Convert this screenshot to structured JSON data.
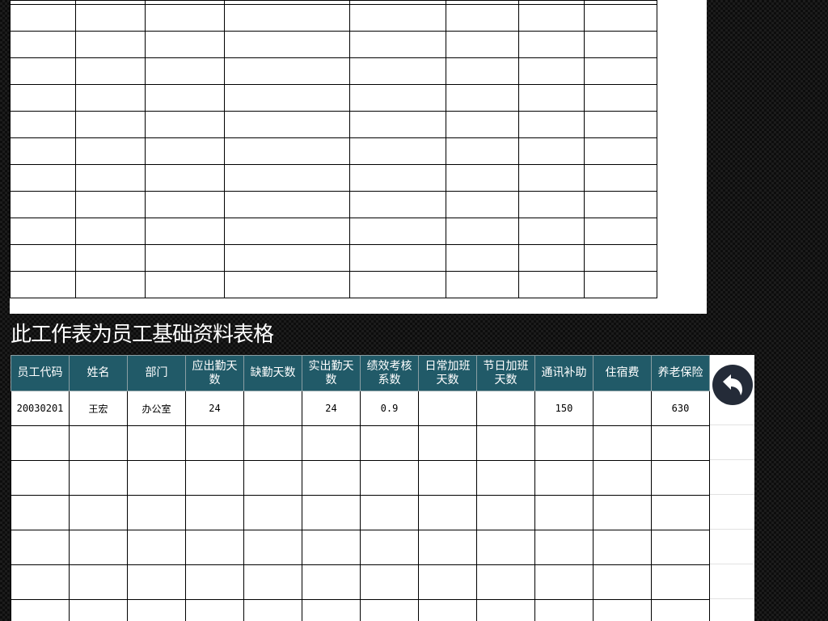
{
  "sheet": {
    "title": "此工作表为员工基础资料表格"
  },
  "employee_table": {
    "columns": [
      "员工代码",
      "姓名",
      "部门",
      "应出勤天数",
      "缺勤天数",
      "实出勤天数",
      "绩效考核系数",
      "日常加班天数",
      "节日加班天数",
      "通讯补助",
      "住宿费",
      "养老保险"
    ],
    "rows": [
      [
        "20030201",
        "王宏",
        "办公室",
        "24",
        "",
        "24",
        "0.9",
        "",
        "",
        "150",
        "",
        "630"
      ],
      [
        "",
        "",
        "",
        "",
        "",
        "",
        "",
        "",
        "",
        "",
        "",
        ""
      ],
      [
        "",
        "",
        "",
        "",
        "",
        "",
        "",
        "",
        "",
        "",
        "",
        ""
      ],
      [
        "",
        "",
        "",
        "",
        "",
        "",
        "",
        "",
        "",
        "",
        "",
        ""
      ],
      [
        "",
        "",
        "",
        "",
        "",
        "",
        "",
        "",
        "",
        "",
        "",
        ""
      ],
      [
        "",
        "",
        "",
        "",
        "",
        "",
        "",
        "",
        "",
        "",
        "",
        ""
      ],
      [
        "",
        "",
        "",
        "",
        "",
        "",
        "",
        "",
        "",
        "",
        "",
        ""
      ]
    ]
  },
  "navigation": {
    "back_icon": "undo-arrow-icon"
  },
  "colors": {
    "header_bg": "#215a68",
    "header_text": "#ffffff",
    "back_button_bg": "#242b38"
  }
}
